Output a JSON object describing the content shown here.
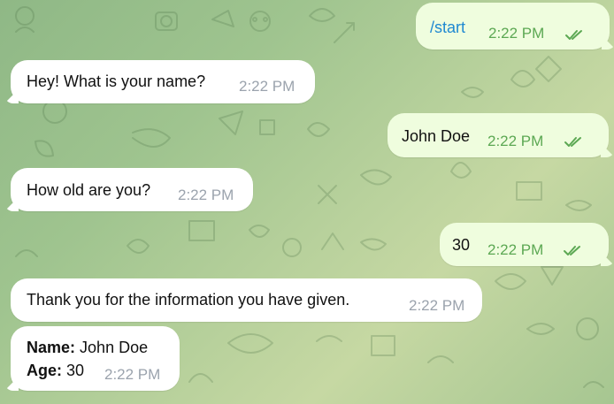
{
  "chat": {
    "messages": [
      {
        "id": "m1",
        "direction": "outgoing",
        "text": "/start",
        "time": "2:22 PM",
        "status": "read"
      },
      {
        "id": "m2",
        "direction": "incoming",
        "text": "Hey! What is your name?",
        "time": "2:22 PM"
      },
      {
        "id": "m3",
        "direction": "outgoing",
        "text": "John Doe",
        "time": "2:22 PM",
        "status": "read"
      },
      {
        "id": "m4",
        "direction": "incoming",
        "text": "How old are you?",
        "time": "2:22 PM"
      },
      {
        "id": "m5",
        "direction": "outgoing",
        "text": "30",
        "time": "2:22 PM",
        "status": "read"
      },
      {
        "id": "m6",
        "direction": "incoming",
        "text": "Thank you for the information you have given.",
        "time": "2:22 PM"
      },
      {
        "id": "m7",
        "direction": "incoming",
        "name_label": "Name:",
        "name_value": "John Doe",
        "age_label": "Age:",
        "age_value": "30",
        "time": "2:22 PM"
      }
    ]
  },
  "colors": {
    "incoming_bubble": "#ffffff",
    "outgoing_bubble": "#effdde",
    "outgoing_time": "#5ca853",
    "incoming_time": "#9ba3ad",
    "command_link": "#1f89d1",
    "background": "#9fc48f"
  },
  "icons": {
    "read_status": "double-check-icon"
  }
}
